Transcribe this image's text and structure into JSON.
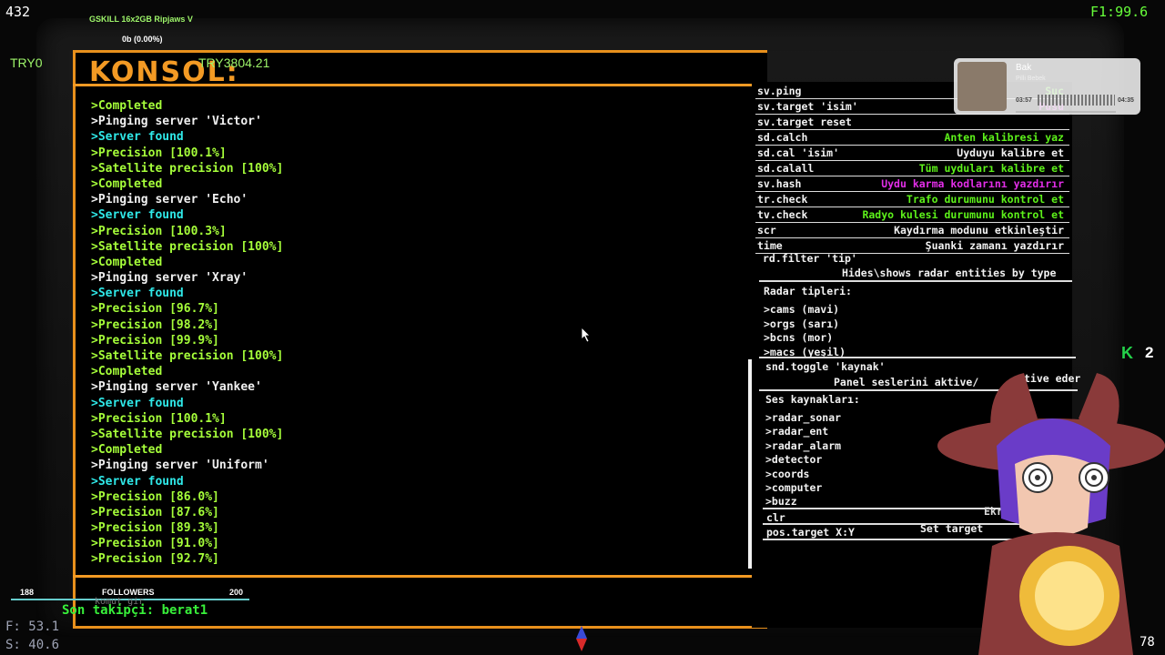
{
  "overlay": {
    "fps": "432",
    "ram_label": "GSKILL 16x2GB Ripjaws V",
    "ram_value": "0b (0.00%)",
    "currency_left": "TRY0",
    "currency_right": "TRY3804.21",
    "frame_stat": "F1:99.6",
    "kick_count": "2",
    "bottom_right_num": "78",
    "f_stat": "F: 53.1",
    "s_stat": "S: 40.6",
    "followers_current": "188",
    "followers_label": "FOLLOWERS",
    "followers_goal": "200",
    "command_hint": "komut gir",
    "last_follower": "Son takipçi: berat1"
  },
  "music": {
    "title": "Bak",
    "artist": "Pilli Bebek",
    "elapsed": "03:57",
    "duration": "04:35"
  },
  "console": {
    "title": "KONSOL:",
    "lines": [
      {
        "text": ">Completed",
        "color": "green"
      },
      {
        "text": ">Pinging server 'Victor'",
        "color": "white"
      },
      {
        "text": ">Server found",
        "color": "cyan"
      },
      {
        "text": ">Precision [100.1%]",
        "color": "green"
      },
      {
        "text": ">Satellite precision [100%]",
        "color": "green"
      },
      {
        "text": ">Completed",
        "color": "green"
      },
      {
        "text": ">Pinging server 'Echo'",
        "color": "white"
      },
      {
        "text": ">Server found",
        "color": "cyan"
      },
      {
        "text": ">Precision [100.3%]",
        "color": "green"
      },
      {
        "text": ">Satellite precision [100%]",
        "color": "green"
      },
      {
        "text": ">Completed",
        "color": "green"
      },
      {
        "text": ">Pinging server 'Xray'",
        "color": "white"
      },
      {
        "text": ">Server found",
        "color": "cyan"
      },
      {
        "text": ">Precision [96.7%]",
        "color": "green"
      },
      {
        "text": ">Precision [98.2%]",
        "color": "green"
      },
      {
        "text": ">Precision [99.9%]",
        "color": "green"
      },
      {
        "text": ">Satellite precision [100%]",
        "color": "green"
      },
      {
        "text": ">Completed",
        "color": "green"
      },
      {
        "text": ">Pinging server 'Yankee'",
        "color": "white"
      },
      {
        "text": ">Server found",
        "color": "cyan"
      },
      {
        "text": ">Precision [100.1%]",
        "color": "green"
      },
      {
        "text": ">Satellite precision [100%]",
        "color": "green"
      },
      {
        "text": ">Completed",
        "color": "green"
      },
      {
        "text": ">Pinging server 'Uniform'",
        "color": "white"
      },
      {
        "text": ">Server found",
        "color": "cyan"
      },
      {
        "text": ">Precision [86.0%]",
        "color": "green"
      },
      {
        "text": ">Precision [87.6%]",
        "color": "green"
      },
      {
        "text": ">Precision [89.3%]",
        "color": "green"
      },
      {
        "text": ">Precision [91.0%]",
        "color": "green"
      },
      {
        "text": ">Precision [92.7%]",
        "color": "green"
      }
    ]
  },
  "help": {
    "commands": [
      {
        "cmd": "sv.ping",
        "desc": "Suc",
        "color": "green"
      },
      {
        "cmd": "sv.target 'isim'",
        "desc": "Pusu",
        "color": "magenta"
      },
      {
        "cmd": "sv.target reset",
        "desc": "",
        "color": "white"
      },
      {
        "cmd": "sd.calch",
        "desc": "Anten kalibresi yaz",
        "color": "green"
      },
      {
        "cmd": "sd.cal 'isim'",
        "desc": "Uyduyu kalibre et",
        "color": "white"
      },
      {
        "cmd": "sd.calall",
        "desc": "Tüm uyduları kalibre et",
        "color": "green"
      },
      {
        "cmd": "sv.hash",
        "desc": "Uydu karma kodlarını yazdırır",
        "color": "magenta"
      },
      {
        "cmd": "tr.check",
        "desc": "Trafo durumunu kontrol et",
        "color": "green"
      },
      {
        "cmd": "tv.check",
        "desc": "Radyo kulesi durumunu kontrol et",
        "color": "green"
      },
      {
        "cmd": "scr",
        "desc": "Kaydırma modunu etkinleştir",
        "color": "white"
      },
      {
        "cmd": "time",
        "desc": "Şuanki zamanı yazdırır",
        "color": "white"
      }
    ],
    "radar_filter_cmd": "rd.filter 'tip'",
    "radar_filter_desc": "Hides\\shows radar entities by type",
    "radar_types_title": "Radar tipleri:",
    "radar_types": [
      ">cams (mavi)",
      ">orgs (sarı)",
      ">bcns (mor)",
      ">macs (yeşil)"
    ],
    "snd_cmd": "snd.toggle 'kaynak'",
    "snd_desc": "Panel seslerini aktive/",
    "snd_desc_end": "tive eder",
    "sound_sources_title": "Ses kaynakları:",
    "sound_sources": [
      ">radar_sonar",
      ">radar_ent",
      ">radar_alarm",
      ">detector",
      ">coords",
      ">computer",
      ">buzz"
    ],
    "clr_cmd": "clr",
    "clr_desc": "Ekran",
    "pos_cmd": "pos.target X:Y",
    "pos_desc": "Set target"
  }
}
